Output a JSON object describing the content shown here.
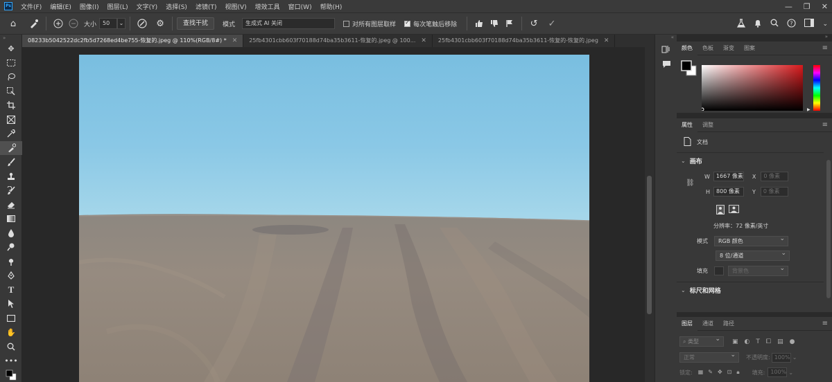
{
  "app": {
    "logo": "Ps"
  },
  "menu": [
    "文件(F)",
    "编辑(E)",
    "图像(I)",
    "图层(L)",
    "文字(Y)",
    "选择(S)",
    "滤镜(T)",
    "视图(V)",
    "增效工具",
    "窗口(W)",
    "帮助(H)"
  ],
  "window_controls": {
    "minimize": "—",
    "restore": "❐",
    "close": "✕"
  },
  "options": {
    "size_label": "大小",
    "size_value": "50",
    "find_distractions": "查找干扰",
    "mode_label": "模式",
    "mode_value": "生成式 AI 关闭",
    "sample_all_layers": "对所有图层取样",
    "sample_all_checked": false,
    "remove_after_stroke": "每次笔触后移除",
    "remove_after_checked": true
  },
  "tabs": [
    {
      "title": "08233b5042522dc2fb5d7268ed4be755-恢复的.jpeg @ 110%(RGB/8#) *",
      "active": true
    },
    {
      "title": "25fb4301cbb603f70188d74ba35b3611-恢复的.jpeg @ 100...",
      "active": false
    },
    {
      "title": "25fb4301cbb603f70188d74ba35b3611-恢复的-恢复的.jpeg",
      "active": false
    }
  ],
  "color_panel": {
    "tabs": [
      "颜色",
      "色板",
      "渐变",
      "图案"
    ],
    "active": 0,
    "hue_color": "#d8191c"
  },
  "properties_panel": {
    "tabs": [
      "属性",
      "调整"
    ],
    "active": 0,
    "doc_label": "文档",
    "canvas_section": "画布",
    "w_label": "W",
    "w_value": "1667 像素",
    "h_label": "H",
    "h_value": "800 像素",
    "x_label": "X",
    "x_value": "0 像素",
    "y_label": "Y",
    "y_value": "0 像素",
    "resolution": "分辨率：72 像素/英寸",
    "mode_label": "模式",
    "mode_value": "RGB 颜色",
    "depth_value": "8 位/通道",
    "fill_label": "填充",
    "fill_value": "背景色",
    "rulers_section": "标尺和网格"
  },
  "layers_panel": {
    "tabs": [
      "图层",
      "通道",
      "路径"
    ],
    "active": 0,
    "kind_label": "类型",
    "blend_mode": "正常",
    "opacity_label": "不透明度:",
    "opacity_value": "100%",
    "lock_label": "锁定:",
    "fill_label": "填充:",
    "fill_value": "100%"
  }
}
